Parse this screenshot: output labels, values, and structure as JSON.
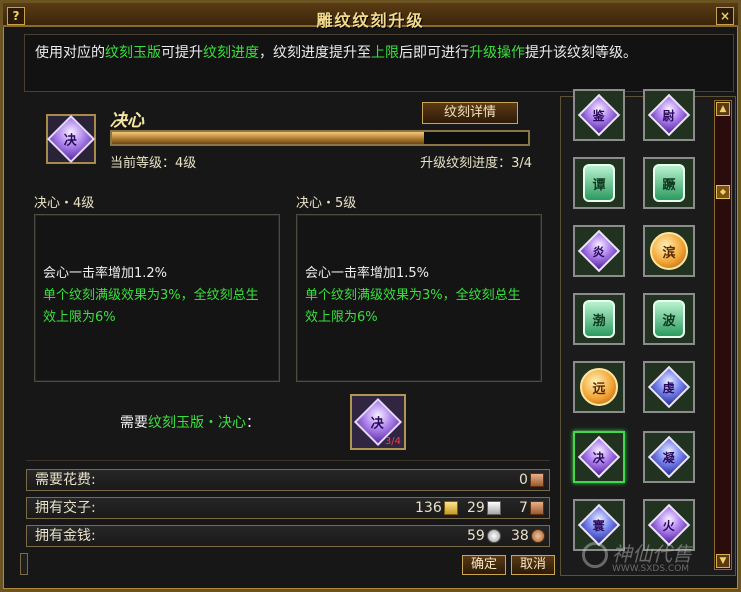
{
  "window": {
    "title": "雕纹纹刻升级",
    "help": "?",
    "close": "×"
  },
  "info": {
    "p1": "使用对应的",
    "h1": "纹刻玉版",
    "p2": "可提升",
    "h2": "纹刻进度",
    "p3": "，纹刻进度提升至",
    "h3": "上限",
    "p4": "后即可进行",
    "h4": "升级操作",
    "p5": "提升该纹刻等级。"
  },
  "item": {
    "name": "决心",
    "glyph": "决",
    "detail_button": "纹刻详情",
    "progress": 0.75,
    "current_level": "当前等级：4级",
    "progress_label": "升级纹刻进度：3/4"
  },
  "current": {
    "header": "决心・4级",
    "line1": "会心一击率增加1.2%",
    "line2": "单个纹刻满级效果为3%，全纹刻总生效上限为6%"
  },
  "next": {
    "header": "决心・5级",
    "line1": "会心一击率增加1.5%",
    "line2": "单个纹刻满级效果为3%，全纹刻总生效上限为6%"
  },
  "requirement": {
    "prefix": "需要",
    "item": "纹刻玉版・决心",
    "suffix": "：",
    "glyph": "决",
    "count": "3/4"
  },
  "costs": {
    "fee_label": "需要花费:",
    "fee_value": "0",
    "jiaozi_label": "拥有交子:",
    "jiaozi_gold": "136",
    "jiaozi_silver": "29",
    "jiaozi_copper": "7",
    "money_label": "拥有金钱:",
    "money_silver": "59",
    "money_copper": "38"
  },
  "buttons": {
    "ok": "确定",
    "cancel": "取消"
  },
  "grid": [
    {
      "glyph": "鉴",
      "kind": "pdiam"
    },
    {
      "glyph": "尉",
      "kind": "pdiam"
    },
    {
      "glyph": "谭",
      "kind": "jade"
    },
    {
      "glyph": "蹶",
      "kind": "jade"
    },
    {
      "glyph": "炎",
      "kind": "pdiam"
    },
    {
      "glyph": "滨",
      "kind": "orb"
    },
    {
      "glyph": "渤",
      "kind": "jade"
    },
    {
      "glyph": "波",
      "kind": "jade"
    },
    {
      "glyph": "远",
      "kind": "orb"
    },
    {
      "glyph": "虔",
      "kind": "bdiam"
    },
    {
      "glyph": "决",
      "kind": "pdiam"
    },
    {
      "glyph": "凝",
      "kind": "bdiam"
    },
    {
      "glyph": "寰",
      "kind": "bdiam"
    },
    {
      "glyph": "火",
      "kind": "pdiam"
    }
  ],
  "scroll": {
    "up": "▲",
    "down": "▼",
    "thumb": "◆"
  },
  "watermark": {
    "title": "神仙代售",
    "url": "WWW.SXDS.COM"
  }
}
